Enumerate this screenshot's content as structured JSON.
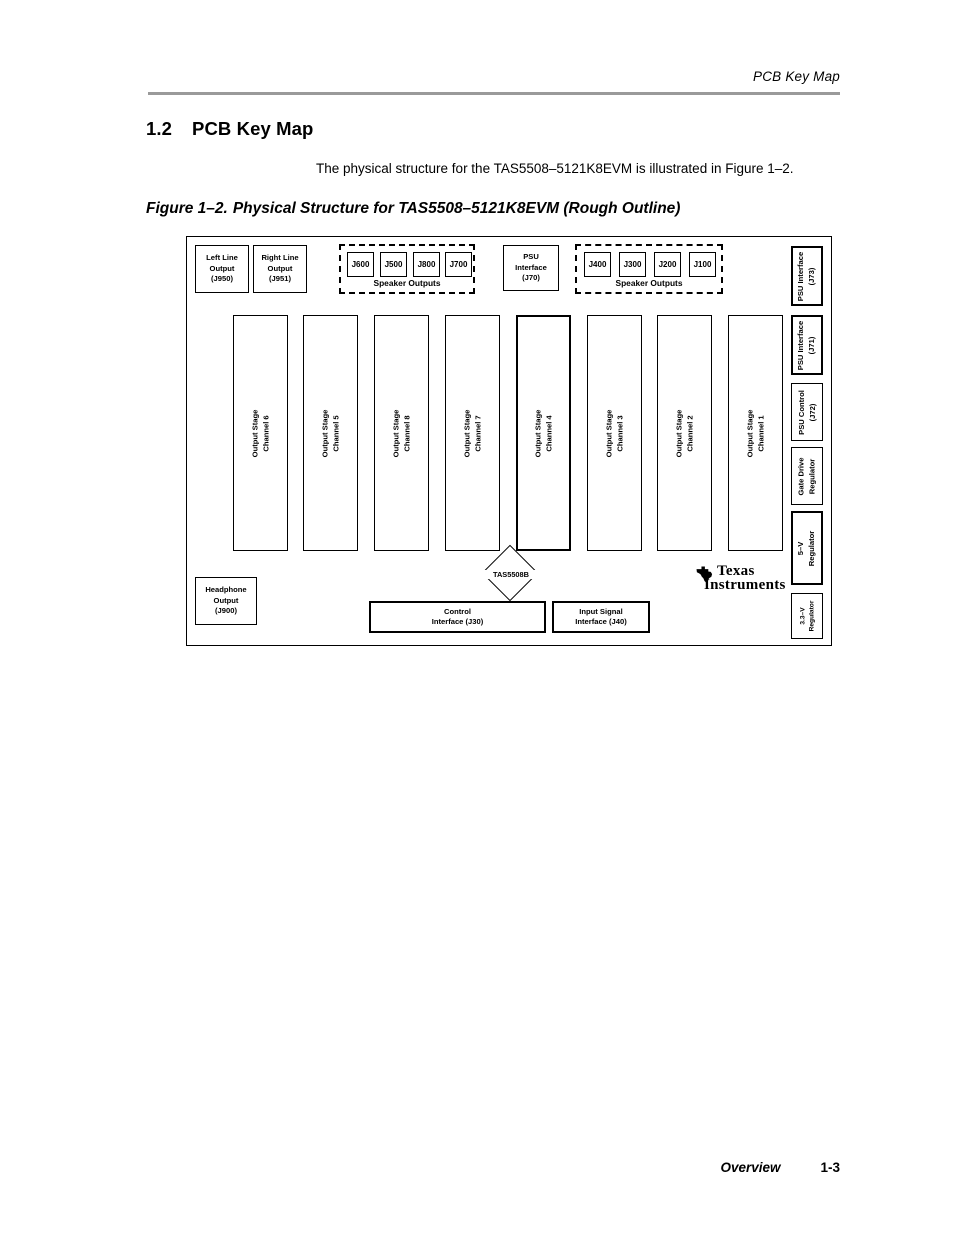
{
  "header": {
    "running_head": "PCB Key Map"
  },
  "section": {
    "number": "1.2",
    "title": "PCB Key Map",
    "body": "The physical structure for the TAS5508–5121K8EVM is illustrated in Figure 1–2."
  },
  "figure": {
    "label": "Figure 1–2.",
    "title": "Physical Structure for TAS5508–5121K8EVM (Rough Outline)"
  },
  "diagram": {
    "line_outputs": [
      {
        "name": "left-line-output",
        "line1": "Left Line",
        "line2": "Output",
        "line3": "(J950)"
      },
      {
        "name": "right-line-output",
        "line1": "Right Line",
        "line2": "Output",
        "line3": "(J951)"
      }
    ],
    "speaker_group_left": {
      "label": "Speaker Outputs",
      "connectors": [
        "J600",
        "J500",
        "J800",
        "J700"
      ]
    },
    "speaker_group_right": {
      "label": "Speaker Outputs",
      "connectors": [
        "J400",
        "J300",
        "J200",
        "J100"
      ]
    },
    "psu_interface_j70": {
      "line1": "PSU",
      "line2": "Interface",
      "line3": "(J70)"
    },
    "output_stages": [
      {
        "line1": "Output Stage",
        "line2": "Channel 6"
      },
      {
        "line1": "Output Stage",
        "line2": "Channel 5"
      },
      {
        "line1": "Output Stage",
        "line2": "Channel 8"
      },
      {
        "line1": "Output Stage",
        "line2": "Channel 7"
      },
      {
        "line1": "Output Stage",
        "line2": "Channel 4"
      },
      {
        "line1": "Output Stage",
        "line2": "Channel 3"
      },
      {
        "line1": "Output Stage",
        "line2": "Channel 2"
      },
      {
        "line1": "Output Stage",
        "line2": "Channel 1"
      }
    ],
    "right_column": [
      {
        "name": "psu-interface-j73",
        "line1": "PSU",
        "line2": "Interface",
        "line3": "(J73)"
      },
      {
        "name": "psu-interface-j71",
        "line1": "PSU",
        "line2": "Interface",
        "line3": "(J71)"
      },
      {
        "name": "psu-control-j72",
        "line1": "PSU",
        "line2": "Control",
        "line3": "(J72)"
      },
      {
        "name": "gate-drive-regulator",
        "line1": "Gate Drive",
        "line2": "Regulator",
        "line3": ""
      },
      {
        "name": "five-volt-regulator",
        "line1": "5–V",
        "line2": "Regulator",
        "line3": ""
      },
      {
        "name": "three-three-volt-regulator",
        "line1": "3.3–V",
        "line2": "Regulator",
        "line3": ""
      }
    ],
    "headphone_output": {
      "line1": "Headphone",
      "line2": "Output",
      "line3": "(J900)"
    },
    "ic": {
      "label": "TAS5508B"
    },
    "control_interface": {
      "line1": "Control",
      "line2": "Interface  (J30)"
    },
    "input_signal_interface": {
      "line1": "Input Signal",
      "line2": "Interface  (J40)"
    },
    "logo": {
      "line1": "Texas",
      "line2": "Instruments"
    }
  },
  "footer": {
    "section_name": "Overview",
    "page_number": "1-3"
  }
}
